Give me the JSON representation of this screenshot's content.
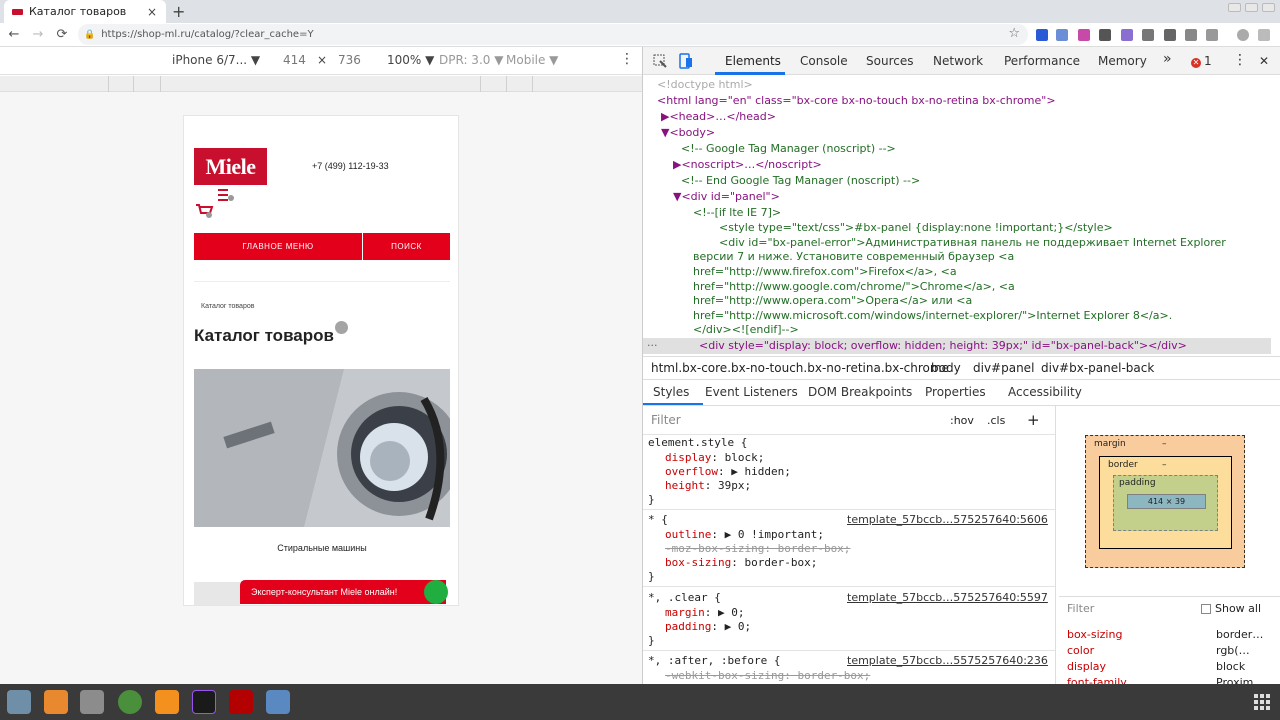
{
  "browser": {
    "tab_title": "Каталог товаров",
    "tab_close": "×",
    "new_tab": "+",
    "url": "https://shop-ml.ru/catalog/?clear_cache=Y",
    "back": "←",
    "forward": "→",
    "reload": "⟳",
    "star": "☆"
  },
  "device_toolbar": {
    "device": "iPhone 6/7... ▼",
    "width": "414",
    "times": "×",
    "height": "736",
    "zoom": "100% ▼",
    "dpr": "DPR: 3.0 ▼",
    "mode": "Mobile ▼",
    "more": "⋮"
  },
  "site": {
    "logo": "Miele",
    "phone": "+7 (499) 112-19-33",
    "menu_main": "ГЛАВНОЕ МЕНЮ",
    "menu_search": "ПОИСК",
    "breadcrumb": "Каталог товаров",
    "heading": "Каталог товаров",
    "product_name": "Стиральные машины",
    "consult": "Эксперт-консультант Miele онлайн!"
  },
  "devtools": {
    "tabs": [
      "Elements",
      "Console",
      "Sources",
      "Network",
      "Performance",
      "Memory"
    ],
    "more_tabs": "»",
    "errors": "1",
    "dock_menu": "⋮",
    "close": "✕",
    "elements": [
      "<!doctype html>",
      "<html lang=\"en\" class=\"bx-core bx-no-touch bx-no-retina bx-chrome\">",
      "▶<head>…</head>",
      "▼<body>",
      "<!-- Google Tag Manager (noscript) -->",
      "▶<noscript>…</noscript>",
      "<!-- End Google Tag Manager (noscript) -->",
      "▼<div id=\"panel\">",
      "<!--[if lte IE 7]>",
      "<style type=\"text/css\">#bx-panel {display:none !important;}</style>",
      "<div id=\"bx-panel-error\">Административная панель не поддерживает Internet Explorer",
      "версии 7 и ниже. Установите современный браузер <a",
      "href=\"http://www.firefox.com\">Firefox</a>, <a",
      "href=\"http://www.google.com/chrome/\">Chrome</a>, <a",
      "href=\"http://www.opera.com\">Opera</a> или <a",
      "href=\"http://www.microsoft.com/windows/internet-explorer/\">Internet Explorer 8</a>.",
      "</div><![endif]-->",
      "<div style=\"display: block; overflow: hidden; height: 39px;\" id=\"bx-panel-back\"></div>"
    ],
    "breadcrumbs": [
      "html.bx-core.bx-no-touch.bx-no-retina.bx-chrome",
      "body",
      "div#panel",
      "div#bx-panel-back"
    ],
    "subtabs": [
      "Styles",
      "Event Listeners",
      "DOM Breakpoints",
      "Properties",
      "Accessibility"
    ],
    "filter_placeholder": "Filter",
    "hov": ":hov",
    "cls": ".cls",
    "plus": "+",
    "styles": {
      "element_style": "element.style {",
      "p1": "display",
      "v1": "block;",
      "p2": "overflow",
      "v2": "▶ hidden;",
      "p3": "height",
      "v3": "39px;",
      "close": "}",
      "rule2_sel": "* {",
      "rule2_src": "template_57bccb…575257640:5606",
      "r2p1": "outline",
      "r2v1": "▶ 0 !important;",
      "r2p2": "-moz-box-sizing: border-box;",
      "r2p3": "box-sizing",
      "r2v3": "border-box;",
      "rule3_sel": "*, .clear {",
      "rule3_src": "template_57bccb…575257640:5597",
      "r3p1": "margin",
      "r3v1": "▶ 0;",
      "r3p2": "padding",
      "r3v2": "▶ 0;",
      "rule4_sel": "*, :after, :before {",
      "rule4_src": "template_57bccb…5575257640:236",
      "r4p1": "-webkit-box-sizing: border-box;"
    },
    "boxmodel": {
      "margin": "margin",
      "border": "border",
      "padding": "padding",
      "content": "414 × 39",
      "dash": "–"
    },
    "computed": {
      "filter": "Filter",
      "show_all": "Show all",
      "rows": [
        {
          "prop": "box-sizing",
          "val": "border…"
        },
        {
          "prop": "color",
          "val": "rgb(…"
        },
        {
          "prop": "display",
          "val": "block"
        },
        {
          "prop": "font-family",
          "val": "Proxim…"
        }
      ]
    }
  },
  "colors": {
    "brand_red": "#e2001a",
    "devtools_blue": "#1a73e8"
  }
}
